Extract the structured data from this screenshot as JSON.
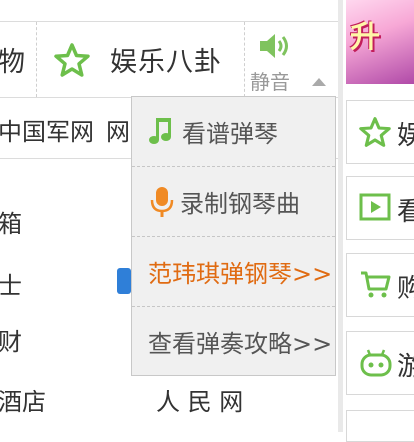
{
  "topnav": {
    "partial_left_label": "物",
    "entertainment_label": "娱乐八卦",
    "mute_label": "静音"
  },
  "left": {
    "govsite_partial": "中国军网",
    "govsite_partial2": "网",
    "rows": [
      "箱",
      "士",
      "财",
      "酒店"
    ],
    "people_site": "人 民 网"
  },
  "popup": {
    "items": [
      {
        "label": "看谱弹琴",
        "icon": "music-note-icon"
      },
      {
        "label": "录制钢琴曲",
        "icon": "microphone-icon"
      },
      {
        "label": "范玮琪弹钢琴>>",
        "link": true
      },
      {
        "label": "查看弹奏攻略>>"
      }
    ]
  },
  "sidebar": {
    "banner_text": "升",
    "items": [
      {
        "icon": "star-icon",
        "text": "娱"
      },
      {
        "icon": "video-play-icon",
        "text": "看"
      },
      {
        "icon": "shopping-cart-icon",
        "text": "购"
      },
      {
        "icon": "gamepad-icon",
        "text": "游"
      }
    ]
  },
  "colors": {
    "accent_green": "#6dbf4b",
    "link_orange": "#e06b12",
    "mic_orange": "#f08a24"
  }
}
